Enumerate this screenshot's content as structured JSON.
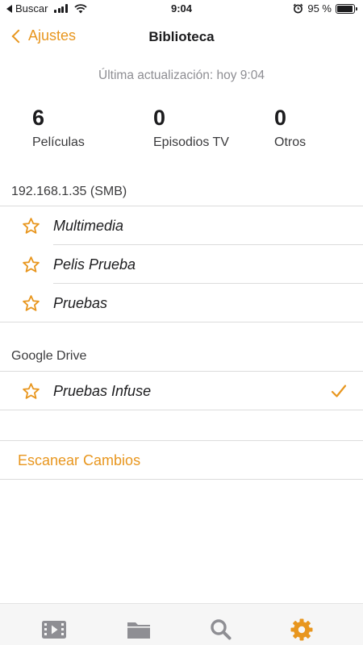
{
  "status_bar": {
    "carrier_back_label": "Buscar",
    "time": "9:04",
    "battery_text": "95 %",
    "battery_level_percent": 95
  },
  "nav": {
    "back_label": "Ajustes",
    "title": "Biblioteca"
  },
  "last_update": "Última actualización: hoy 9:04",
  "stats": [
    {
      "value": "6",
      "label": "Películas"
    },
    {
      "value": "0",
      "label": "Episodios TV"
    },
    {
      "value": "0",
      "label": "Otros"
    }
  ],
  "sources": [
    {
      "header": "192.168.1.35 (SMB)",
      "items": [
        {
          "label": "Multimedia",
          "checked": false
        },
        {
          "label": "Pelis Prueba",
          "checked": false
        },
        {
          "label": "Pruebas",
          "checked": false
        }
      ]
    },
    {
      "header": "Google Drive",
      "items": [
        {
          "label": "Pruebas Infuse",
          "checked": true
        }
      ]
    }
  ],
  "scan_label": "Escanear Cambios",
  "tabs": [
    {
      "icon": "video-library-icon",
      "active": false
    },
    {
      "icon": "folder-icon",
      "active": false
    },
    {
      "icon": "search-icon",
      "active": false
    },
    {
      "icon": "gear-icon",
      "active": true
    }
  ],
  "colors": {
    "accent": "#e8961e",
    "inactive_tab": "#8e8e93",
    "secondary_text": "#8e8e93",
    "divider": "#dcdcdc"
  }
}
